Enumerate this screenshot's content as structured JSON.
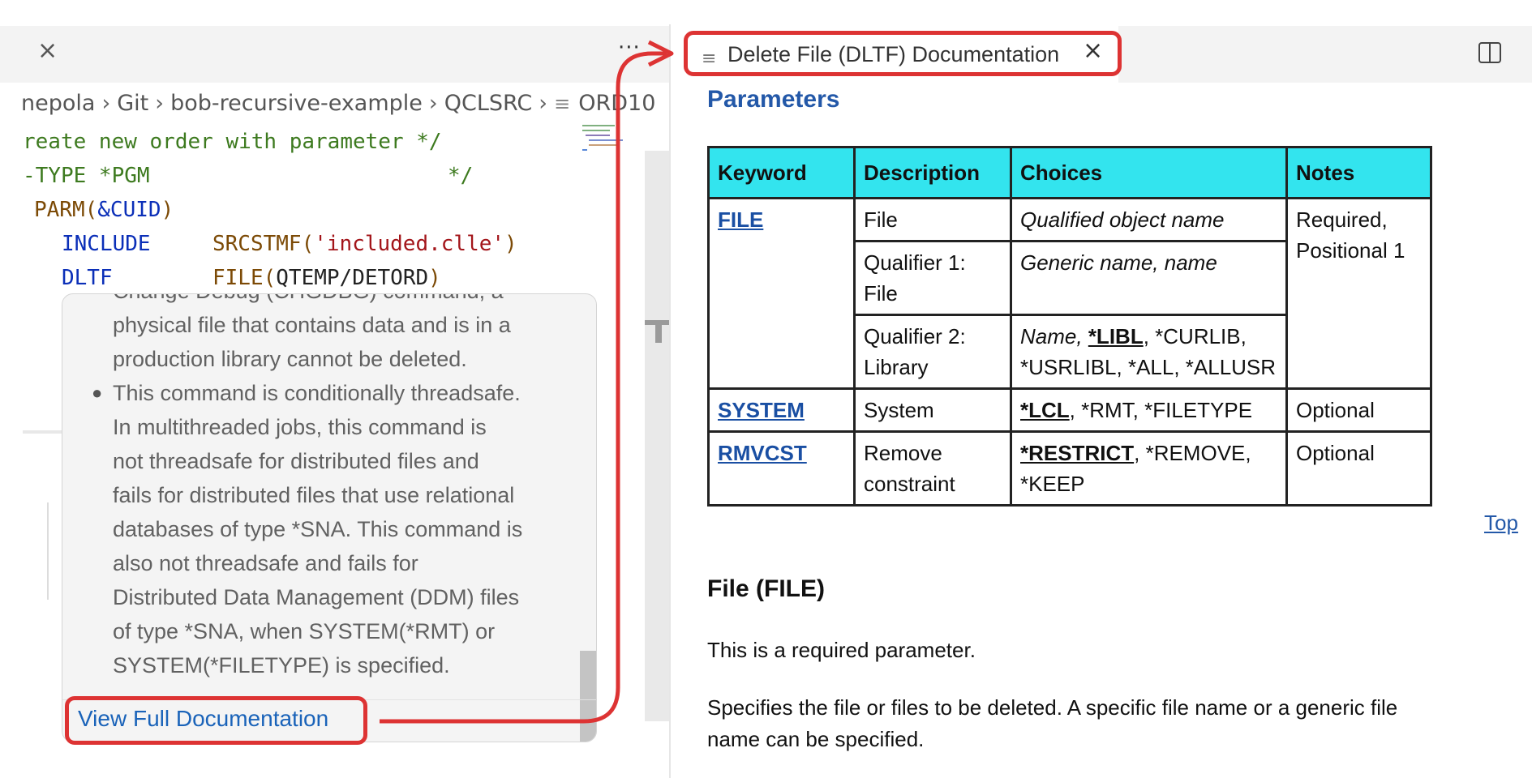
{
  "left_editor": {
    "tab_close": "×",
    "more_actions": "···",
    "breadcrumb": [
      "nepola",
      "Git",
      "bob-recursive-example",
      "QCLSRC"
    ],
    "breadcrumb_file": "ORD10",
    "code_lines": {
      "l1": "reate new order with parameter */",
      "l2_a": "-TYPE *PGM",
      "l2_b": "*/",
      "l3_a": "PARM(",
      "l3_b": "&CUID",
      "l3_c": ")",
      "l4_kw": "INCLUDE",
      "l4_fn": "SRCSTMF(",
      "l4_str": "'included.clle'",
      "l4_end": ")",
      "l5_kw": "DLTF",
      "l5_fn": "FILE(",
      "l5_arg": "QTEMP/DETORD",
      "l5_end": ")"
    }
  },
  "hover": {
    "partial_top": "Change Debug (CHGDBG) command, a",
    "lines": [
      "physical file that contains data and is in a",
      "production library cannot be deleted.",
      "This command is conditionally threadsafe.",
      "In multithreaded jobs, this command is",
      "not threadsafe for distributed files and",
      "fails for distributed files that use relational",
      "databases of type *SNA. This command is",
      "also not threadsafe and fails for",
      "Distributed Data Management (DDM) files",
      "of type *SNA, when SYSTEM(*RMT) or",
      "SYSTEM(*FILETYPE) is specified."
    ],
    "view_docs_label": "View Full Documentation"
  },
  "doc": {
    "tab_title": "Delete File (DLTF) Documentation",
    "tab_close": "×",
    "parameters_heading": "Parameters",
    "table": {
      "headers": [
        "Keyword",
        "Description",
        "Choices",
        "Notes"
      ],
      "file_keyword": "FILE",
      "file_desc": "File",
      "file_choice": "Qualified object name",
      "file_notes": "Required, Positional 1",
      "q1_desc": "Qualifier 1: File",
      "q1_choice": "Generic name, name",
      "q2_desc": "Qualifier 2: Library",
      "q2_choice_a": "Name, ",
      "q2_choice_b": "*LIBL",
      "q2_choice_c": ", *CURLIB, *USRLIBL, *ALL, *ALLUSR",
      "system_keyword": "SYSTEM",
      "system_desc": "System",
      "system_choice_a": "*LCL",
      "system_choice_b": ", *RMT, *FILETYPE",
      "system_notes": "Optional",
      "rmvcst_keyword": "RMVCST",
      "rmvcst_desc": "Remove constraint",
      "rmvcst_choice_a": "*RESTRICT",
      "rmvcst_choice_b": ", *REMOVE, *KEEP",
      "rmvcst_notes": "Optional"
    },
    "top_link": "Top",
    "file_heading": "File (FILE)",
    "required_text": "This is a required parameter.",
    "spec_text": "Specifies the file or files to be deleted. A specific file name or a generic file name can be specified."
  },
  "colors": {
    "accent_link": "#1a63b9",
    "table_header": "#33e4ee",
    "callout": "#dd3333"
  }
}
